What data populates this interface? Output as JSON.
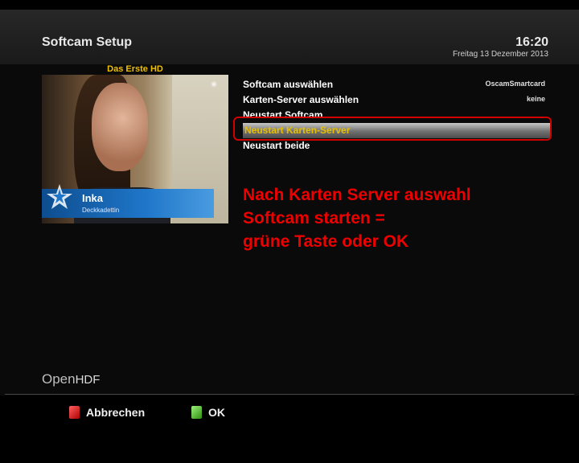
{
  "header": {
    "title": "Softcam Setup",
    "time": "16:20",
    "date": "Freitag 13 Dezember 2013"
  },
  "preview": {
    "channel": "Das Erste HD",
    "lower_third_name": "Inka",
    "lower_third_role": "Deckkadettin"
  },
  "menu": {
    "items": [
      {
        "label": "Softcam auswählen",
        "value": "OscamSmartcard"
      },
      {
        "label": "Karten-Server auswählen",
        "value": "keine"
      },
      {
        "label": "Neustart Softcam",
        "value": ""
      },
      {
        "label": "Neustart Karten-Server",
        "value": ""
      },
      {
        "label": "Neustart beide",
        "value": ""
      }
    ],
    "selected_index": 3
  },
  "annotation": {
    "line1": "Nach Karten Server auswahl",
    "line2": "Softcam starten =",
    "line3": "grüne Taste oder OK"
  },
  "brand": {
    "part1": "Open",
    "part2": "HDF"
  },
  "footer": {
    "cancel_label": "Abbrechen",
    "ok_label": "OK"
  },
  "colors": {
    "annotation": "#ee0000",
    "selected_text": "#e8c000",
    "channel_name": "#f0c000",
    "red_key": "#d00000",
    "green_key": "#2f8f10"
  }
}
